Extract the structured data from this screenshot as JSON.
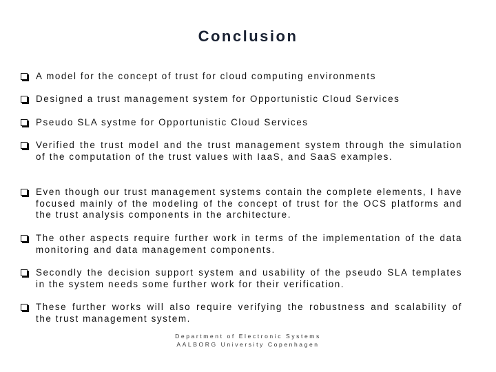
{
  "slide": {
    "title": "Conclusion",
    "bullets": [
      "A model for the concept of trust for cloud computing environments",
      "Designed a trust management system for Opportunistic Cloud Services",
      "Pseudo SLA systme for Opportunistic Cloud Services",
      "Verified the trust model and the trust management system through the simulation of the computation of the trust values with IaaS, and SaaS examples.",
      "Even though our trust management systems contain the complete elements, I have focused mainly of the modeling of the concept of trust for the OCS platforms and the trust analysis components in the architecture.",
      "The other aspects require further work in terms of the implementation of the data monitoring and data management components.",
      "Secondly the decision support system and usability of the pseudo SLA templates in the system needs some further work for their verification.",
      "These further works will also require verifying the robustness and scalability of the trust management system."
    ],
    "footer": {
      "line1": "Department of Electronic Systems",
      "line2": "AALBORG University Copenhagen"
    }
  }
}
